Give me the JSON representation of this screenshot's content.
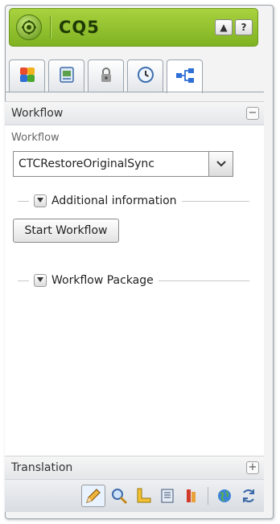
{
  "header": {
    "title": "CQ5",
    "collapse_glyph": "▲",
    "help_glyph": "?",
    "logo_icon": "cq5-logo-icon"
  },
  "tabs": [
    {
      "icon": "components-icon",
      "active": false
    },
    {
      "icon": "page-icon",
      "active": false
    },
    {
      "icon": "lock-icon",
      "active": false
    },
    {
      "icon": "versioning-clock-icon",
      "active": false
    },
    {
      "icon": "workflow-icon",
      "active": true
    }
  ],
  "workflow_panel": {
    "title": "Workflow",
    "collapse_glyph": "−",
    "field_label": "Workflow",
    "selected_workflow": "CTCRestoreOriginalSync",
    "additional_info_label": "Additional information",
    "start_button": "Start Workflow",
    "package_label": "Workflow Package"
  },
  "translation_panel": {
    "title": "Translation",
    "expand_glyph": "+"
  },
  "toolbar": {
    "tools": [
      "edit-pencil-icon",
      "preview-magnifier-icon",
      "design-ruler-icon",
      "scaffolding-icon",
      "client-context-icon",
      "website-globe-icon",
      "refresh-icon"
    ]
  },
  "colors": {
    "header_green": "#8fbf2b",
    "panel_bg": "#f3f3f3",
    "border": "#9aa3ad"
  }
}
